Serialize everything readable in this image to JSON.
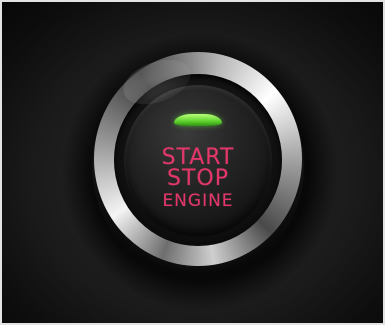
{
  "button": {
    "line1": "START",
    "line2": "STOP",
    "line3": "ENGINE"
  },
  "colors": {
    "label": "#e3376b",
    "indicator": "#5fd22e",
    "ring": "#cfcfcf",
    "background": "#151515"
  },
  "icons": {
    "indicator": "green-led-indicator-icon"
  }
}
